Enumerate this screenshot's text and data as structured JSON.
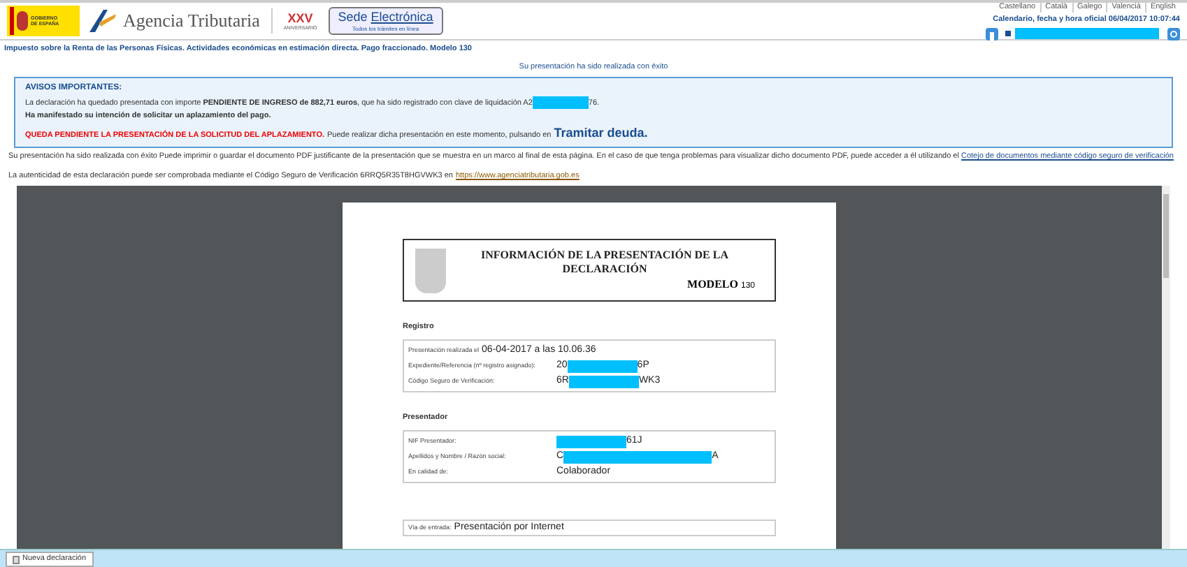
{
  "header": {
    "gov_logo": "GOBIERNO DE ESPAÑA",
    "agency": "Agencia Tributaria",
    "anniversary_number": "XXV",
    "anniversary": "ANIVERSARIO",
    "sede_title_a": "Sede ",
    "sede_title_b": "Electrónica",
    "sede_sub": "Todos los trámites en línea",
    "languages": [
      "Castellano",
      "Català",
      "Galego",
      "Valencià",
      "English"
    ],
    "calendar": "Calendario, fecha y hora oficial 06/04/2017 10:07:44"
  },
  "page_title": "Impuesto sobre la Renta de las Personas Físicas. Actividades económicas en estimación directa. Pago fraccionado. Modelo 130",
  "success_message": "Su presentación ha sido realizada con éxito",
  "notice": {
    "title": "AVISOS IMPORTANTES:",
    "line1": "La declaración ha quedado presentada con importe **PENDIENTE DE INGRESO de 882,71 euros**, que ha sido registrado con clave de liquidación A2",
    "line1_suffix": "76.",
    "line2": "Ha manifestado su intención de solicitar un aplazamiento del pago.",
    "warning": "QUEDA PENDIENTE LA PRESENTACIÓN DE LA SOLICITUD DEL APLAZAMIENTO.",
    "line3": "Puede realizar dicha presentación en este momento, pulsando en",
    "link": "Tramitar deuda."
  },
  "info_paragraph": "Su presentación ha sido realizada con éxito Puede imprimir o guardar el documento PDF justificante de la presentación que se muestra en un marco al final de esta página. En el caso de que tenga problemas para visualizar dicho documento PDF, puede acceder a él utilizando el",
  "info_link": "Cotejo de documentos mediante código seguro de verificación",
  "authenticity": "La autenticidad de esta declaración puede ser comprobada mediante el Código Seguro de Verificación 6RRQ5R35T8HGVWK3 en",
  "authenticity_link": "https://www.agenciatributaria.gob.es",
  "pdf": {
    "title": "INFORMACIÓN DE LA PRESENTACIÓN DE LA DECLARACIÓN",
    "modelo_label": "MODELO",
    "modelo": "130",
    "sections": [
      {
        "title": "Registro",
        "rows": [
          {
            "label": "Presentación realizada el",
            "value_prefix": "06-04-2017 a las 10.06.36",
            "redacted": false
          },
          {
            "label": "Expediente/Referencia (nº registro asignado):",
            "value_prefix": "20",
            "value_suffix": "6P",
            "redacted": true
          },
          {
            "label": "Código Seguro de Verificación:",
            "value_prefix": "6R",
            "value_suffix": "WK3",
            "redacted": true
          }
        ]
      },
      {
        "title": "Presentador",
        "rows": [
          {
            "label": "NIF Presentador:",
            "value_suffix": "61J",
            "redacted": true
          },
          {
            "label": "Apellidos y Nombre / Razón social:",
            "value_prefix": "C",
            "value_suffix": "A",
            "redacted": true
          },
          {
            "label": "En calidad de:",
            "value_prefix": "Colaborador",
            "redacted": false
          }
        ]
      }
    ],
    "last_row": {
      "label": "Vía de entrada:",
      "value": "Presentación por Internet"
    }
  },
  "taskbar": {
    "tab": "Nueva declaración"
  }
}
